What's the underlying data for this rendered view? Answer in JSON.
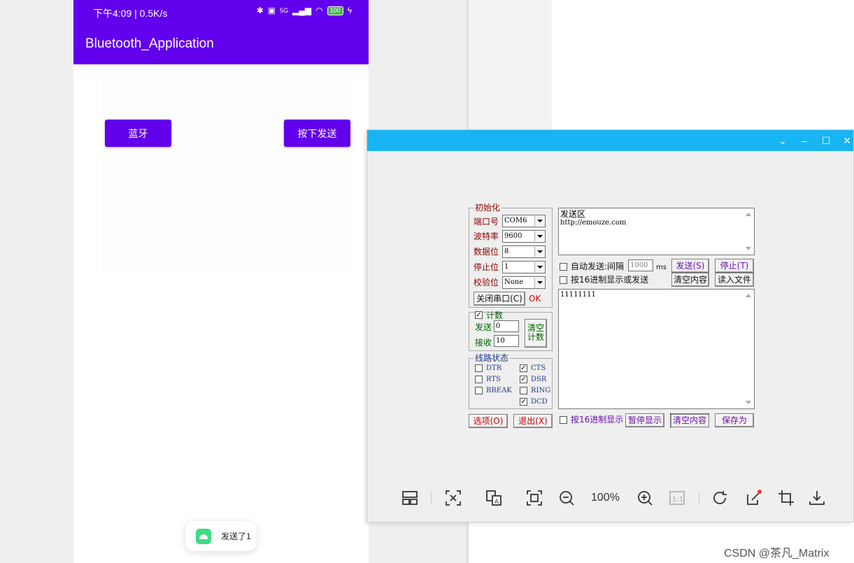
{
  "phone": {
    "status_time": "下午4:09 | 0.5K/s",
    "status_signal": "5G",
    "status_battery": "100",
    "app_title": "Bluetooth_Application",
    "btn_bluetooth": "蓝牙",
    "btn_send": "按下发送",
    "toast_text": "发送了1"
  },
  "viewer": {
    "zoom_level": "100%",
    "ratio_label": "1:1"
  },
  "serial": {
    "init_title": "初始化",
    "port_label": "端口号",
    "port_value": "COM6",
    "baud_label": "波特率",
    "baud_value": "9600",
    "databits_label": "数据位",
    "databits_value": "8",
    "stopbits_label": "停止位",
    "stopbits_value": "1",
    "parity_label": "校验位",
    "parity_value": "None",
    "close_port_button": "关闭串口(C)",
    "status_ok": "OK",
    "count_label": "计数",
    "count_checked": true,
    "send_count_label": "发送",
    "send_count_value": "0",
    "recv_count_label": "接收",
    "recv_count_value": "10",
    "clear_count_button_line1": "清空",
    "clear_count_button_line2": "计数",
    "line_state_title": "线路状态",
    "dtr": "DTR",
    "rts": "RTS",
    "break": "BREAK",
    "cts": "CTS",
    "dsr": "DSR",
    "ring": "RING",
    "dcd": "DCD",
    "options_button": "选项(O)",
    "exit_button": "退出(X)",
    "send_area_title": "发送区",
    "send_area_text": "http://emouze.com",
    "auto_send_label": "自动发送:间隔",
    "interval_value": "1000",
    "interval_unit": "ms",
    "send_button": "发送(S)",
    "stop_button": "停止(T)",
    "hex_send_label": "按16进制显示或发送",
    "clear_content_button": "清空内容",
    "read_file_button": "读入文件",
    "receive_text": "11111111",
    "hex_display_label": "按16进制显示",
    "pause_button": "暂停显示",
    "clear_content_button_2": "清空内容",
    "save_as_button": "保存为"
  },
  "watermark": "CSDN @茶凡_Matrix"
}
